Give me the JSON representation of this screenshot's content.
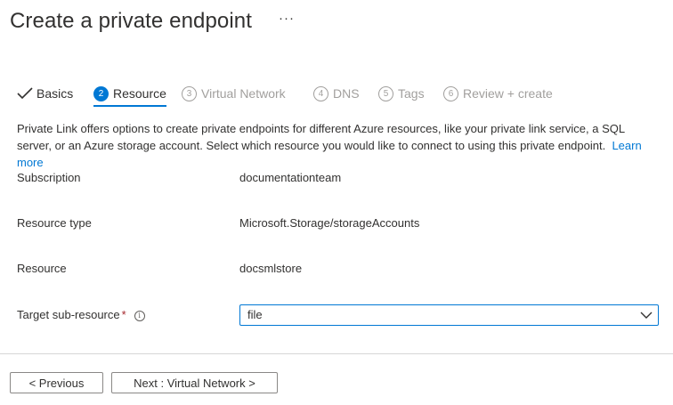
{
  "header": {
    "title": "Create a private endpoint",
    "more_label": "···"
  },
  "steps": [
    {
      "number": "",
      "label": "Basics",
      "state": "done"
    },
    {
      "number": "2",
      "label": "Resource",
      "state": "active"
    },
    {
      "number": "3",
      "label": "Virtual Network",
      "state": "disabled"
    },
    {
      "number": "4",
      "label": "DNS",
      "state": "disabled"
    },
    {
      "number": "5",
      "label": "Tags",
      "state": "disabled"
    },
    {
      "number": "6",
      "label": "Review + create",
      "state": "disabled"
    }
  ],
  "description": {
    "text": "Private Link offers options to create private endpoints for different Azure resources, like your private link service, a SQL server, or an Azure storage account. Select which resource you would like to connect to using this private endpoint.",
    "link": "Learn more"
  },
  "fields": {
    "subscription": {
      "label": "Subscription",
      "value": "documentationteam"
    },
    "resource_type": {
      "label": "Resource type",
      "value": "Microsoft.Storage/storageAccounts"
    },
    "resource": {
      "label": "Resource",
      "value": "docsmlstore"
    },
    "target_sub_resource": {
      "label": "Target sub-resource",
      "required_mark": "*",
      "info_glyph": "i",
      "value": "file"
    }
  },
  "footer": {
    "previous_label": "< Previous",
    "next_label": "Next : Virtual Network >"
  },
  "colors": {
    "accent": "#0078d4",
    "text": "#323130",
    "disabled": "#a19f9d",
    "required": "#a4262c"
  }
}
